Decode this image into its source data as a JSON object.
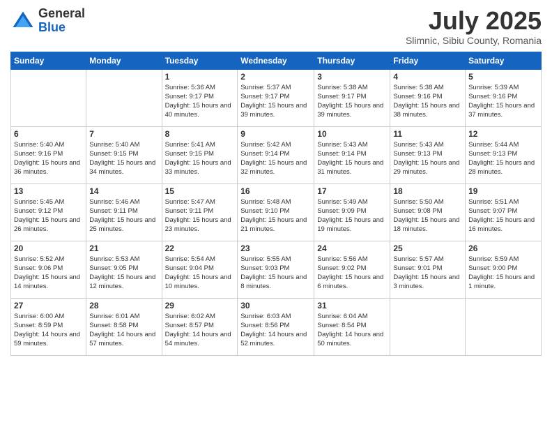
{
  "logo": {
    "general": "General",
    "blue": "Blue"
  },
  "header": {
    "month": "July 2025",
    "location": "Slimnic, Sibiu County, Romania"
  },
  "weekdays": [
    "Sunday",
    "Monday",
    "Tuesday",
    "Wednesday",
    "Thursday",
    "Friday",
    "Saturday"
  ],
  "weeks": [
    [
      {
        "day": "",
        "sunrise": "",
        "sunset": "",
        "daylight": ""
      },
      {
        "day": "",
        "sunrise": "",
        "sunset": "",
        "daylight": ""
      },
      {
        "day": "1",
        "sunrise": "Sunrise: 5:36 AM",
        "sunset": "Sunset: 9:17 PM",
        "daylight": "Daylight: 15 hours and 40 minutes."
      },
      {
        "day": "2",
        "sunrise": "Sunrise: 5:37 AM",
        "sunset": "Sunset: 9:17 PM",
        "daylight": "Daylight: 15 hours and 39 minutes."
      },
      {
        "day": "3",
        "sunrise": "Sunrise: 5:38 AM",
        "sunset": "Sunset: 9:17 PM",
        "daylight": "Daylight: 15 hours and 39 minutes."
      },
      {
        "day": "4",
        "sunrise": "Sunrise: 5:38 AM",
        "sunset": "Sunset: 9:16 PM",
        "daylight": "Daylight: 15 hours and 38 minutes."
      },
      {
        "day": "5",
        "sunrise": "Sunrise: 5:39 AM",
        "sunset": "Sunset: 9:16 PM",
        "daylight": "Daylight: 15 hours and 37 minutes."
      }
    ],
    [
      {
        "day": "6",
        "sunrise": "Sunrise: 5:40 AM",
        "sunset": "Sunset: 9:16 PM",
        "daylight": "Daylight: 15 hours and 36 minutes."
      },
      {
        "day": "7",
        "sunrise": "Sunrise: 5:40 AM",
        "sunset": "Sunset: 9:15 PM",
        "daylight": "Daylight: 15 hours and 34 minutes."
      },
      {
        "day": "8",
        "sunrise": "Sunrise: 5:41 AM",
        "sunset": "Sunset: 9:15 PM",
        "daylight": "Daylight: 15 hours and 33 minutes."
      },
      {
        "day": "9",
        "sunrise": "Sunrise: 5:42 AM",
        "sunset": "Sunset: 9:14 PM",
        "daylight": "Daylight: 15 hours and 32 minutes."
      },
      {
        "day": "10",
        "sunrise": "Sunrise: 5:43 AM",
        "sunset": "Sunset: 9:14 PM",
        "daylight": "Daylight: 15 hours and 31 minutes."
      },
      {
        "day": "11",
        "sunrise": "Sunrise: 5:43 AM",
        "sunset": "Sunset: 9:13 PM",
        "daylight": "Daylight: 15 hours and 29 minutes."
      },
      {
        "day": "12",
        "sunrise": "Sunrise: 5:44 AM",
        "sunset": "Sunset: 9:13 PM",
        "daylight": "Daylight: 15 hours and 28 minutes."
      }
    ],
    [
      {
        "day": "13",
        "sunrise": "Sunrise: 5:45 AM",
        "sunset": "Sunset: 9:12 PM",
        "daylight": "Daylight: 15 hours and 26 minutes."
      },
      {
        "day": "14",
        "sunrise": "Sunrise: 5:46 AM",
        "sunset": "Sunset: 9:11 PM",
        "daylight": "Daylight: 15 hours and 25 minutes."
      },
      {
        "day": "15",
        "sunrise": "Sunrise: 5:47 AM",
        "sunset": "Sunset: 9:11 PM",
        "daylight": "Daylight: 15 hours and 23 minutes."
      },
      {
        "day": "16",
        "sunrise": "Sunrise: 5:48 AM",
        "sunset": "Sunset: 9:10 PM",
        "daylight": "Daylight: 15 hours and 21 minutes."
      },
      {
        "day": "17",
        "sunrise": "Sunrise: 5:49 AM",
        "sunset": "Sunset: 9:09 PM",
        "daylight": "Daylight: 15 hours and 19 minutes."
      },
      {
        "day": "18",
        "sunrise": "Sunrise: 5:50 AM",
        "sunset": "Sunset: 9:08 PM",
        "daylight": "Daylight: 15 hours and 18 minutes."
      },
      {
        "day": "19",
        "sunrise": "Sunrise: 5:51 AM",
        "sunset": "Sunset: 9:07 PM",
        "daylight": "Daylight: 15 hours and 16 minutes."
      }
    ],
    [
      {
        "day": "20",
        "sunrise": "Sunrise: 5:52 AM",
        "sunset": "Sunset: 9:06 PM",
        "daylight": "Daylight: 15 hours and 14 minutes."
      },
      {
        "day": "21",
        "sunrise": "Sunrise: 5:53 AM",
        "sunset": "Sunset: 9:05 PM",
        "daylight": "Daylight: 15 hours and 12 minutes."
      },
      {
        "day": "22",
        "sunrise": "Sunrise: 5:54 AM",
        "sunset": "Sunset: 9:04 PM",
        "daylight": "Daylight: 15 hours and 10 minutes."
      },
      {
        "day": "23",
        "sunrise": "Sunrise: 5:55 AM",
        "sunset": "Sunset: 9:03 PM",
        "daylight": "Daylight: 15 hours and 8 minutes."
      },
      {
        "day": "24",
        "sunrise": "Sunrise: 5:56 AM",
        "sunset": "Sunset: 9:02 PM",
        "daylight": "Daylight: 15 hours and 6 minutes."
      },
      {
        "day": "25",
        "sunrise": "Sunrise: 5:57 AM",
        "sunset": "Sunset: 9:01 PM",
        "daylight": "Daylight: 15 hours and 3 minutes."
      },
      {
        "day": "26",
        "sunrise": "Sunrise: 5:59 AM",
        "sunset": "Sunset: 9:00 PM",
        "daylight": "Daylight: 15 hours and 1 minute."
      }
    ],
    [
      {
        "day": "27",
        "sunrise": "Sunrise: 6:00 AM",
        "sunset": "Sunset: 8:59 PM",
        "daylight": "Daylight: 14 hours and 59 minutes."
      },
      {
        "day": "28",
        "sunrise": "Sunrise: 6:01 AM",
        "sunset": "Sunset: 8:58 PM",
        "daylight": "Daylight: 14 hours and 57 minutes."
      },
      {
        "day": "29",
        "sunrise": "Sunrise: 6:02 AM",
        "sunset": "Sunset: 8:57 PM",
        "daylight": "Daylight: 14 hours and 54 minutes."
      },
      {
        "day": "30",
        "sunrise": "Sunrise: 6:03 AM",
        "sunset": "Sunset: 8:56 PM",
        "daylight": "Daylight: 14 hours and 52 minutes."
      },
      {
        "day": "31",
        "sunrise": "Sunrise: 6:04 AM",
        "sunset": "Sunset: 8:54 PM",
        "daylight": "Daylight: 14 hours and 50 minutes."
      },
      {
        "day": "",
        "sunrise": "",
        "sunset": "",
        "daylight": ""
      },
      {
        "day": "",
        "sunrise": "",
        "sunset": "",
        "daylight": ""
      }
    ]
  ]
}
